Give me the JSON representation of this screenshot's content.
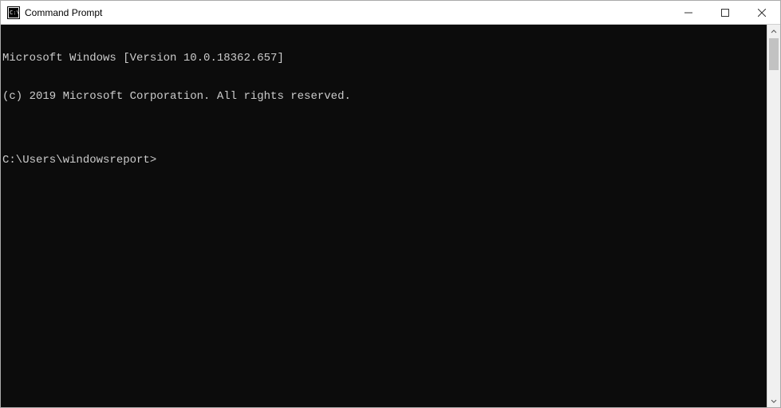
{
  "window": {
    "title": "Command Prompt"
  },
  "terminal": {
    "line1": "Microsoft Windows [Version 10.0.18362.657]",
    "line2": "(c) 2019 Microsoft Corporation. All rights reserved.",
    "blank": "",
    "prompt": "C:\\Users\\windowsreport>"
  }
}
